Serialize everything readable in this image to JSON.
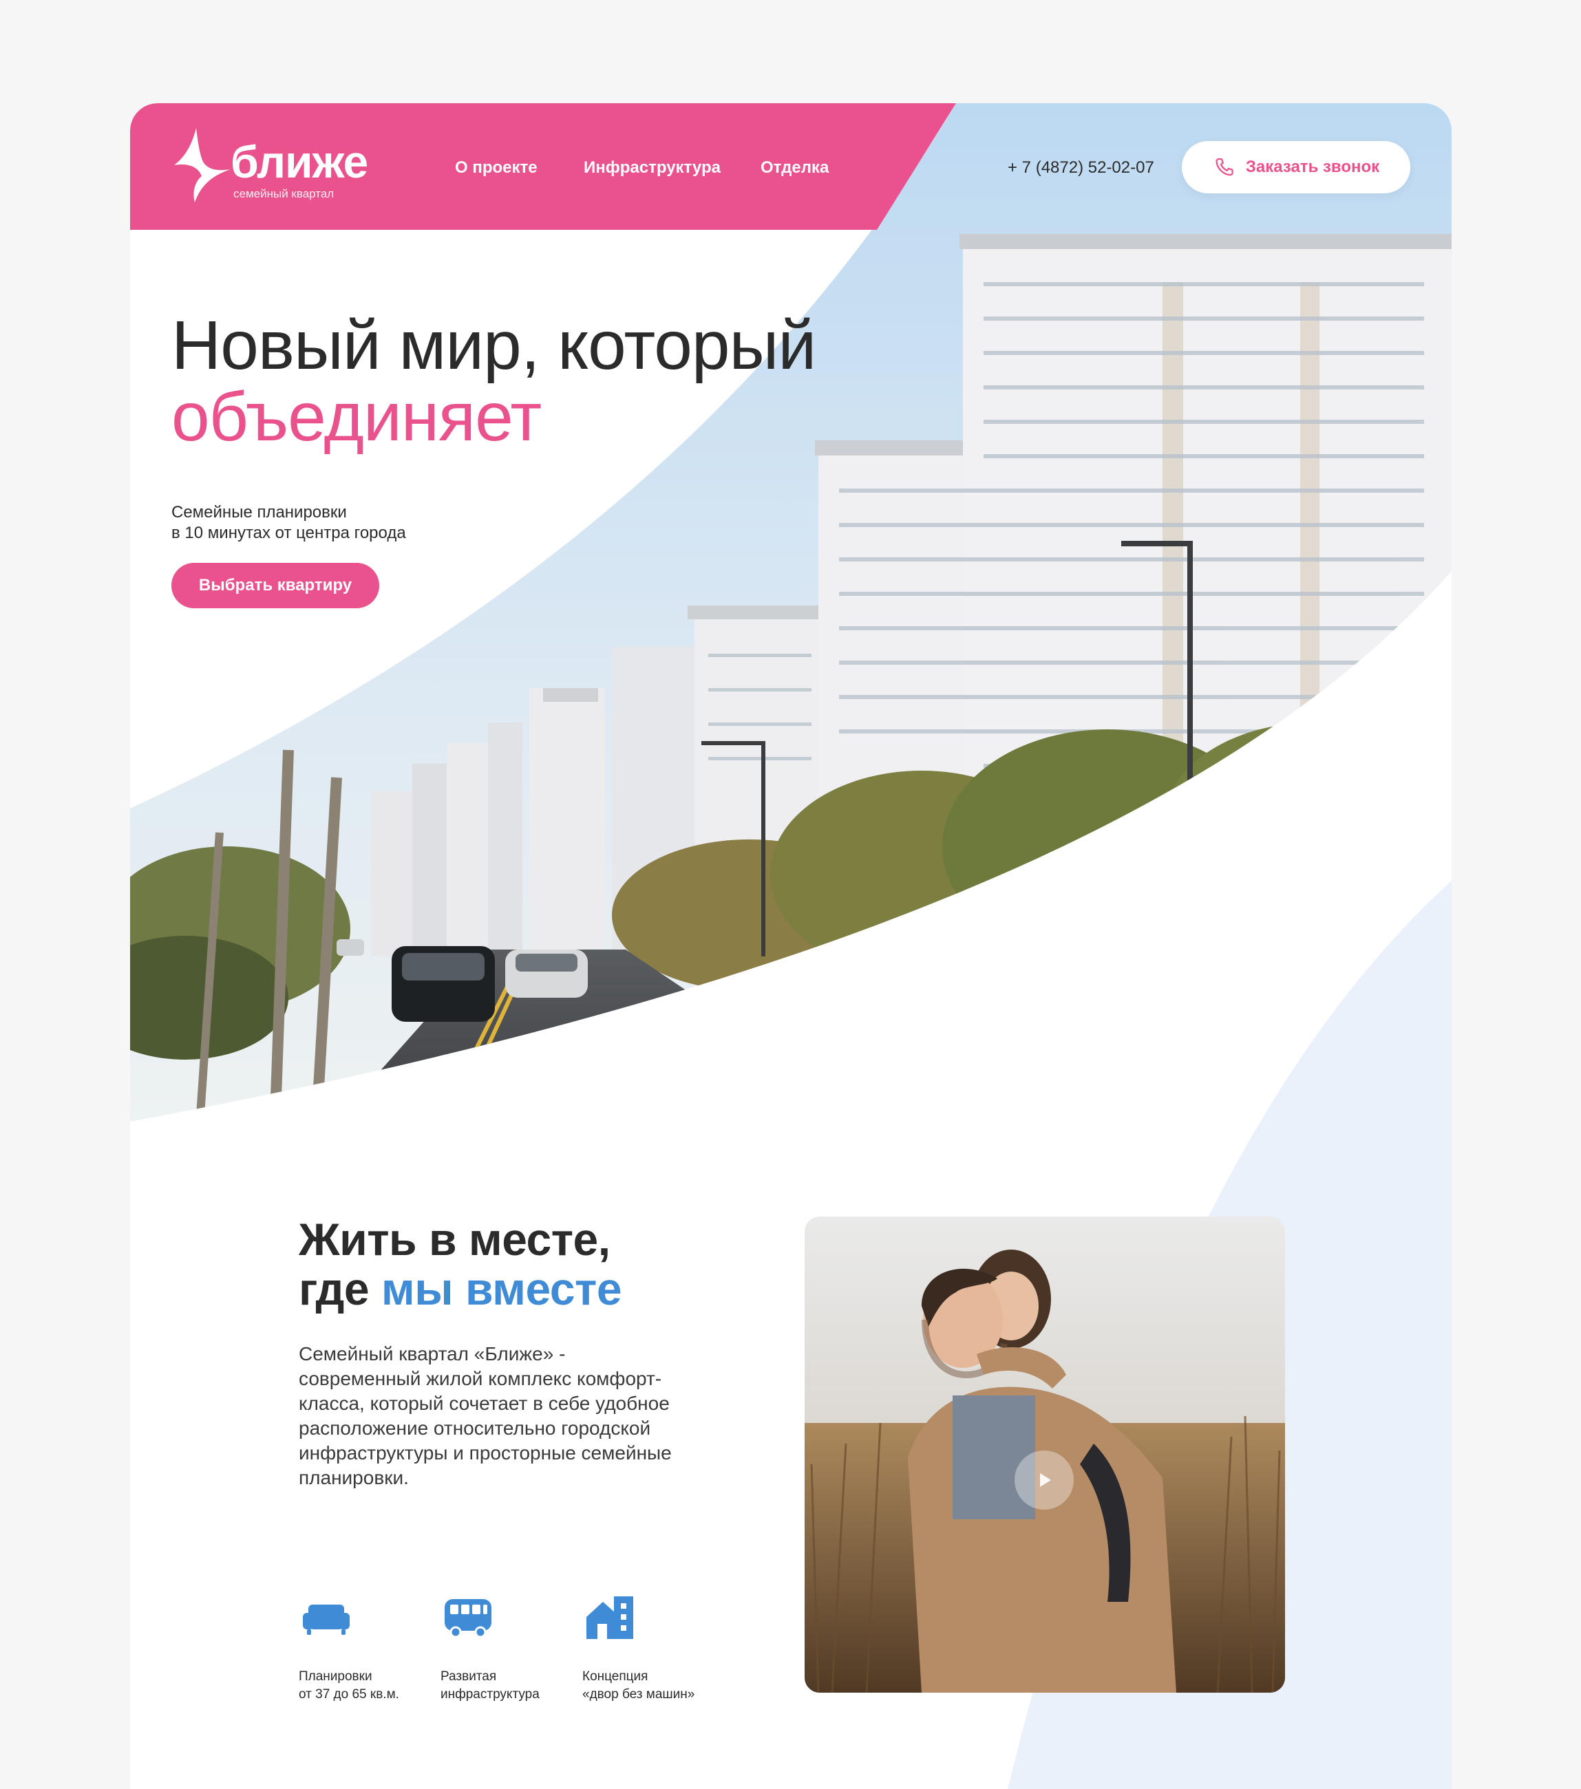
{
  "brand": {
    "name": "ближе",
    "tagline": "семейный квартал",
    "colors": {
      "accent_pink": "#e9528c",
      "accent_blue": "#3f8bd6",
      "light_blue": "#eaf1fb"
    }
  },
  "nav": {
    "items": [
      {
        "label": "О проекте"
      },
      {
        "label": "Инфраструктура"
      },
      {
        "label": "Отделка"
      }
    ]
  },
  "header": {
    "phone": "+ 7 (4872) 52-02-07",
    "call_button_label": "Заказать звонок",
    "call_button_icon": "phone-icon"
  },
  "hero": {
    "title_line1": "Новый мир, который",
    "title_line2": "объединяет",
    "subtitle_line1": "Семейные планировки",
    "subtitle_line2": "в 10 минутах от центра города",
    "cta_label": "Выбрать квартиру"
  },
  "about": {
    "title_line1": "Жить в месте,",
    "title_line2_plain": "где ",
    "title_line2_accent": "мы вместе",
    "text": "Семейный квартал «Ближе» - современный жилой комплекс комфорт-класса, который сочетает в себе удобное расположение относительно городской инфраструктуры и просторные семейные планировки.",
    "features": [
      {
        "icon": "sofa-icon",
        "line1": "Планировки",
        "line2": "от 37 до 65 кв.м."
      },
      {
        "icon": "bus-icon",
        "line1": "Развитая",
        "line2": "инфраструктура"
      },
      {
        "icon": "house-icon",
        "line1": "Концепция",
        "line2": "«двор без машин»"
      }
    ],
    "video_icon": "play-icon"
  }
}
